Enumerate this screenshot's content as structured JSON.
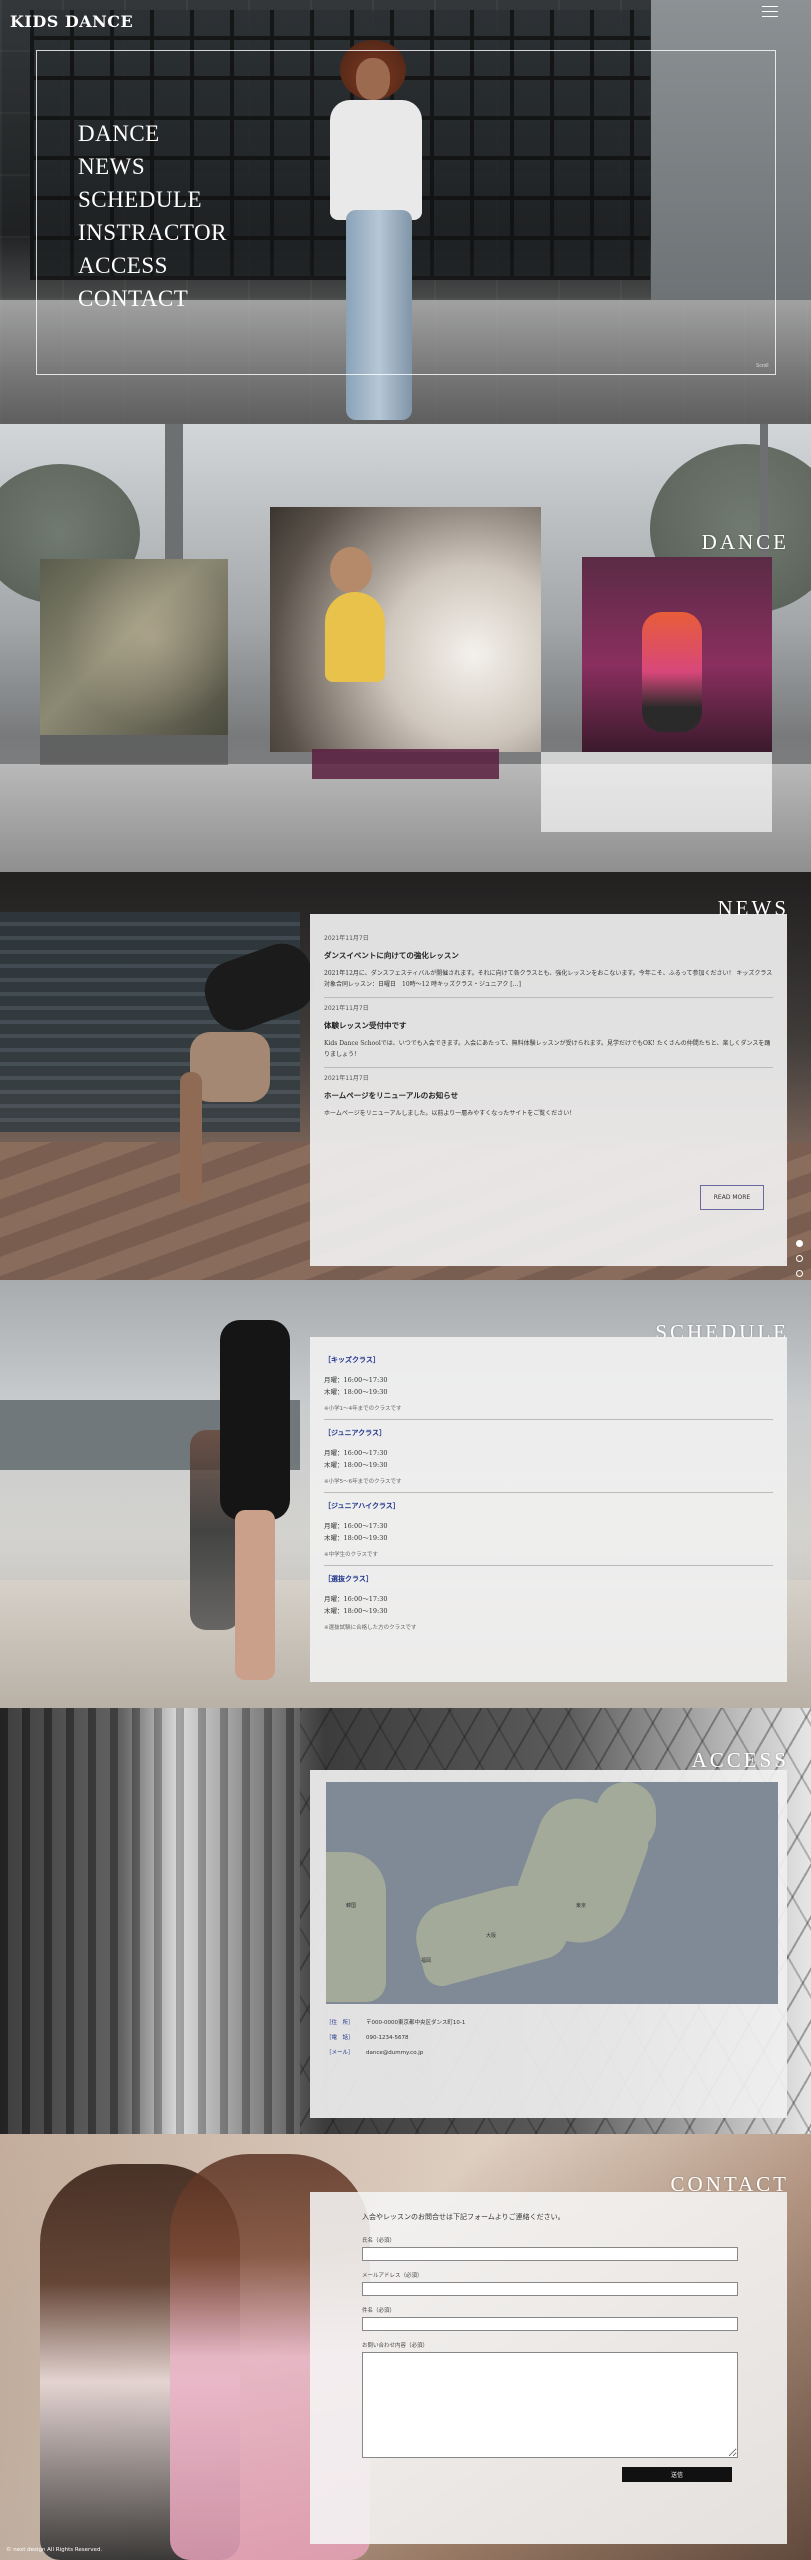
{
  "header": {
    "logo": "KIDS DANCE",
    "menu_icon": "hamburger-icon"
  },
  "hero": {
    "nav": [
      "DANCE",
      "NEWS",
      "SCHEDULE",
      "INSTRACTOR",
      "ACCESS",
      "CONTACT"
    ],
    "scroll_label": "Scroll"
  },
  "dance": {
    "title": "DANCE"
  },
  "news": {
    "title": "NEWS",
    "items": [
      {
        "date": "2021年11月7日",
        "title": "ダンスイベントに向けての強化レッスン",
        "body": "2021年12月に、ダンスフェスティバルが開催されます。それに向けて各クラスとも、強化レッスンをおこないます。今年こそ、ふるって参加ください！ キッズクラス対象合同レッスン：日曜日　10時～12 時キッズクラス・ジュニアク […]"
      },
      {
        "date": "2021年11月7日",
        "title": "体験レッスン受付中です",
        "body": "Kids Dance Schoolでは、いつでも入会できます。入会にあたって、無料体験レッスンが受けられます。見学だけでもOK! たくさんの仲間たちと、楽しくダンスを踊りましょう！"
      },
      {
        "date": "2021年11月7日",
        "title": "ホームページをリニューアルのお知らせ",
        "body": "ホームページをリニューアルしました。以前より一層みやすくなったサイトをご覧ください！"
      }
    ],
    "read_more": "READ MORE"
  },
  "schedule": {
    "title": "SCHEDULE",
    "classes": [
      {
        "name": "［キッズクラス］",
        "lines": [
          "月曜：16:00～17:30",
          "木曜：18:00～19:30"
        ],
        "note": "※小学1～4年までのクラスです"
      },
      {
        "name": "［ジュニアクラス］",
        "lines": [
          "月曜：16:00～17:30",
          "木曜：18:00～19:30"
        ],
        "note": "※小学5～6年までのクラスです"
      },
      {
        "name": "［ジュニアハイクラス］",
        "lines": [
          "月曜：16:00～17:30",
          "木曜：18:00～19:30"
        ],
        "note": "※中学生のクラスです"
      },
      {
        "name": "［選抜クラス］",
        "lines": [
          "月曜：16:00～17:30",
          "木曜：18:00～19:30"
        ],
        "note": "※選抜試験に合格した方のクラスです"
      }
    ]
  },
  "access": {
    "title": "ACCESS",
    "map_labels": [
      "韓国",
      "東京",
      "大阪",
      "福岡"
    ],
    "rows": [
      {
        "key": "［住　所］",
        "value": "〒000-0000東京都中央区ダンス町10-1"
      },
      {
        "key": "［電　話］",
        "value": "090-1234-5678"
      },
      {
        "key": "［メール］",
        "value": "dance@dummy.co.jp"
      }
    ]
  },
  "contact": {
    "title": "CONTACT",
    "intro": "入会やレッスンのお問合せは下記フォームよりご連絡ください。",
    "fields": {
      "name_label": "氏名（必須）",
      "email_label": "メールアドレス（必須）",
      "subject_label": "件名（必須）",
      "message_label": "お問い合わせ内容（必須）"
    },
    "submit": "送信"
  },
  "footer": {
    "copyright": "© next design All Rights Reserved."
  },
  "colors": {
    "accent": "#1b2f8a",
    "button": "#111111"
  }
}
